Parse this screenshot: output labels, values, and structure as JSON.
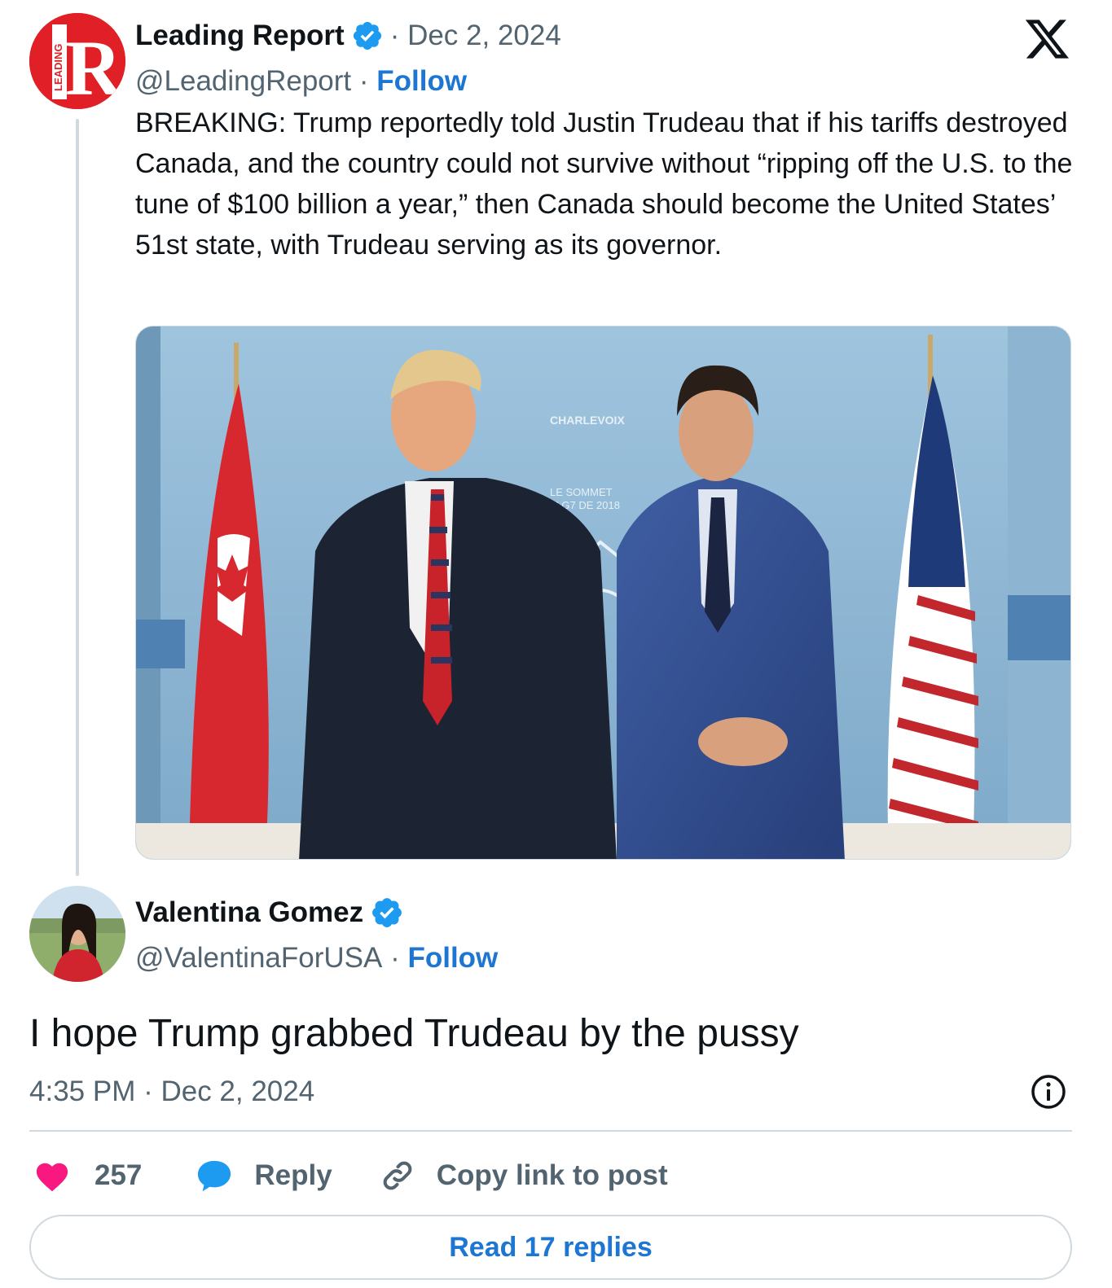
{
  "tweet": {
    "author_name": "Leading Report",
    "separator_date": "· Dec 2, 2024",
    "handle": "@LeadingReport",
    "handle_sep": " · ",
    "follow_label": "Follow",
    "avatar_letter": "R",
    "avatar_side_text": "LEADING",
    "text": "BREAKING: Trump reportedly told Justin Trudeau that if his tariffs destroyed Canada, and the country could not survive without “ripping off the U.S. to the tune of $100 billion a year,” then Canada should become the United States’ 51st state, with Trudeau serving as its governor.",
    "photo_sign_texts": [
      "CHARLEVOIX",
      "LE SOMMET",
      "DU G7 DE 2018"
    ]
  },
  "reply": {
    "author_name": "Valentina Gomez",
    "handle": "@ValentinaForUSA",
    "handle_sep": " · ",
    "follow_label": "Follow",
    "text": "I hope Trump grabbed Trudeau by the pussy",
    "timestamp": "4:35 PM · Dec 2, 2024"
  },
  "actions": {
    "like_count": "257",
    "reply_label": "Reply",
    "copy_label": "Copy link to post",
    "read_replies_label": "Read 17 replies"
  },
  "colors": {
    "brand_red": "#e01f26",
    "link_blue": "#1d76d2",
    "verified_blue": "#1d9bf0",
    "heart_pink": "#f91880",
    "muted_gray": "#536471"
  }
}
